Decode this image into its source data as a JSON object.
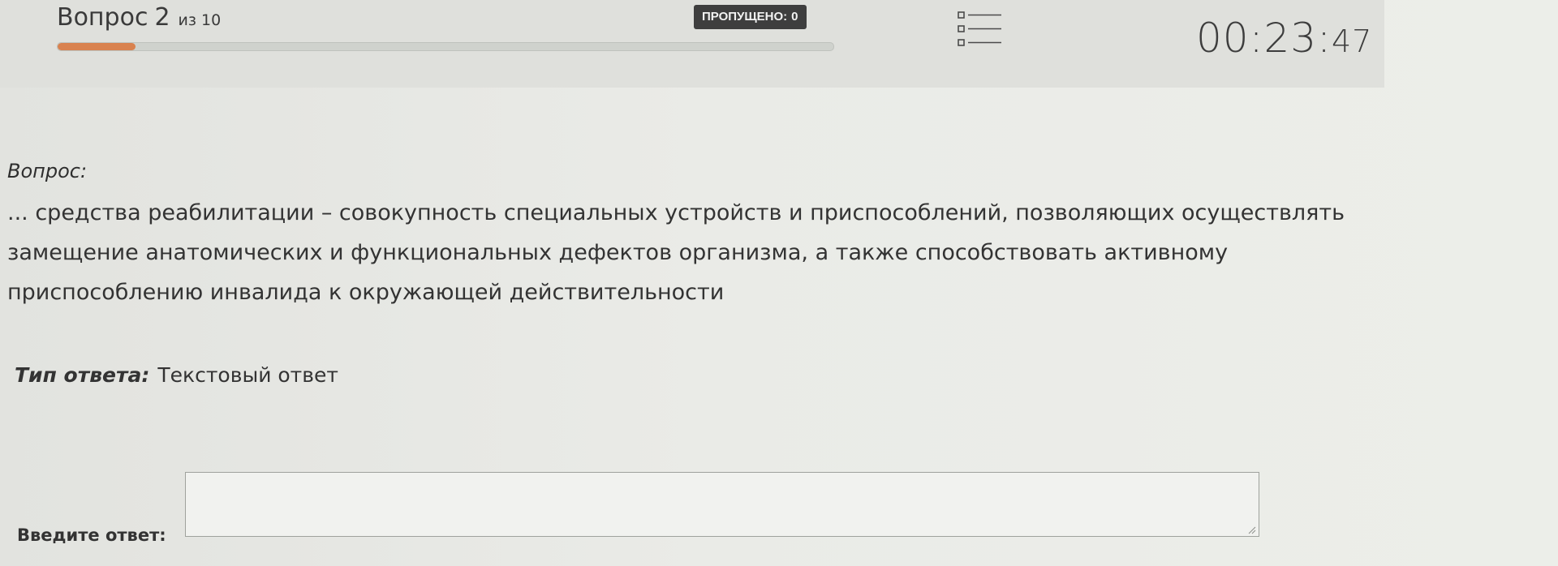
{
  "header": {
    "question_label": "Вопрос",
    "question_number": "2",
    "of_label": "из",
    "question_total": "10",
    "progress_fraction": 0.1,
    "skipped_label": "ПРОПУЩЕНО:",
    "skipped_count": "0",
    "list_icon": "question-list-icon",
    "timer": {
      "hh_mm": "00:23:",
      "ss": "47"
    }
  },
  "question": {
    "heading": "Вопрос:",
    "text": "... средства реабилитации – совокупность специальных устройств и приспособлений, позволяющих осуществлять замещение анатомических и функциональных дефектов организма, а также способствовать активному приспособлению инвалида к окружающей действительности"
  },
  "answer_type": {
    "label": "Тип ответа:",
    "value": "Текстовый ответ"
  },
  "answer": {
    "label": "Введите ответ:",
    "value": ""
  },
  "colors": {
    "progress_fill": "#d9824f",
    "badge_bg": "#3e3e3e",
    "background": "#e7e8e4"
  }
}
